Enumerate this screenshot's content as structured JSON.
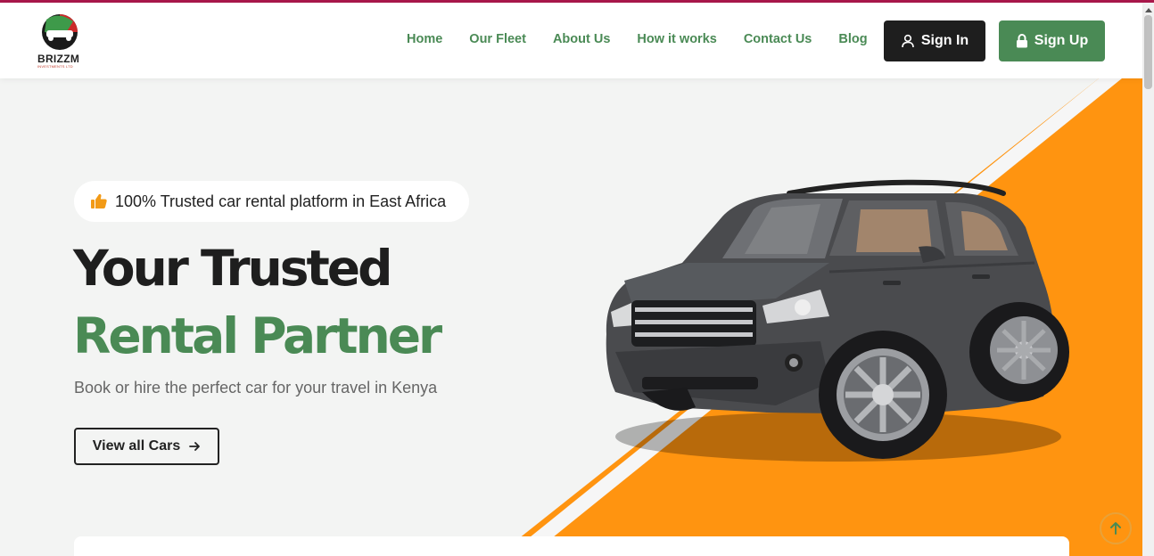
{
  "brand": {
    "name": "BRIZZM",
    "tagline": "INVESTMENTS LTD"
  },
  "nav": {
    "items": [
      {
        "label": "Home"
      },
      {
        "label": "Our Fleet"
      },
      {
        "label": "About Us"
      },
      {
        "label": "How it works"
      },
      {
        "label": "Contact Us"
      },
      {
        "label": "Blog"
      }
    ],
    "signin_label": "Sign In",
    "signup_label": "Sign Up"
  },
  "hero": {
    "badge_text": "100% Trusted car rental platform in East Africa",
    "title_line1": "Your Trusted",
    "title_line2": "Rental Partner",
    "subtitle": "Book or hire the perfect car for your travel in Kenya",
    "cta_label": "View all Cars"
  },
  "icons": {
    "badge": "thumbs-up-icon",
    "signin": "user-icon",
    "signup": "lock-icon",
    "cta": "arrow-right-icon",
    "to_top": "arrow-up-icon"
  },
  "colors": {
    "accent_green": "#4a8a55",
    "orange": "#ff9410",
    "dark": "#1e1e1e",
    "top_line": "#a8174a"
  }
}
